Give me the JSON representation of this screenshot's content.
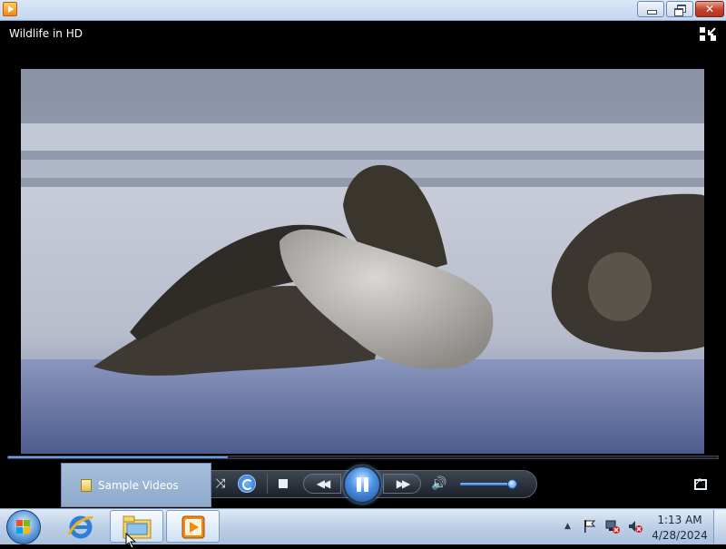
{
  "window": {
    "video_title": "Wildlife in HD"
  },
  "player": {
    "seek_progress": 0.31,
    "volume": 0.85,
    "state": "playing"
  },
  "jumplist": {
    "item_label": "Sample Videos"
  },
  "taskbar": {
    "clock_time": "1:13 AM",
    "clock_date": "4/28/2024",
    "apps": [
      "internet-explorer",
      "windows-explorer",
      "windows-media-player"
    ]
  },
  "colors": {
    "accent": "#3a7fd8",
    "close_button": "#c4452a"
  }
}
